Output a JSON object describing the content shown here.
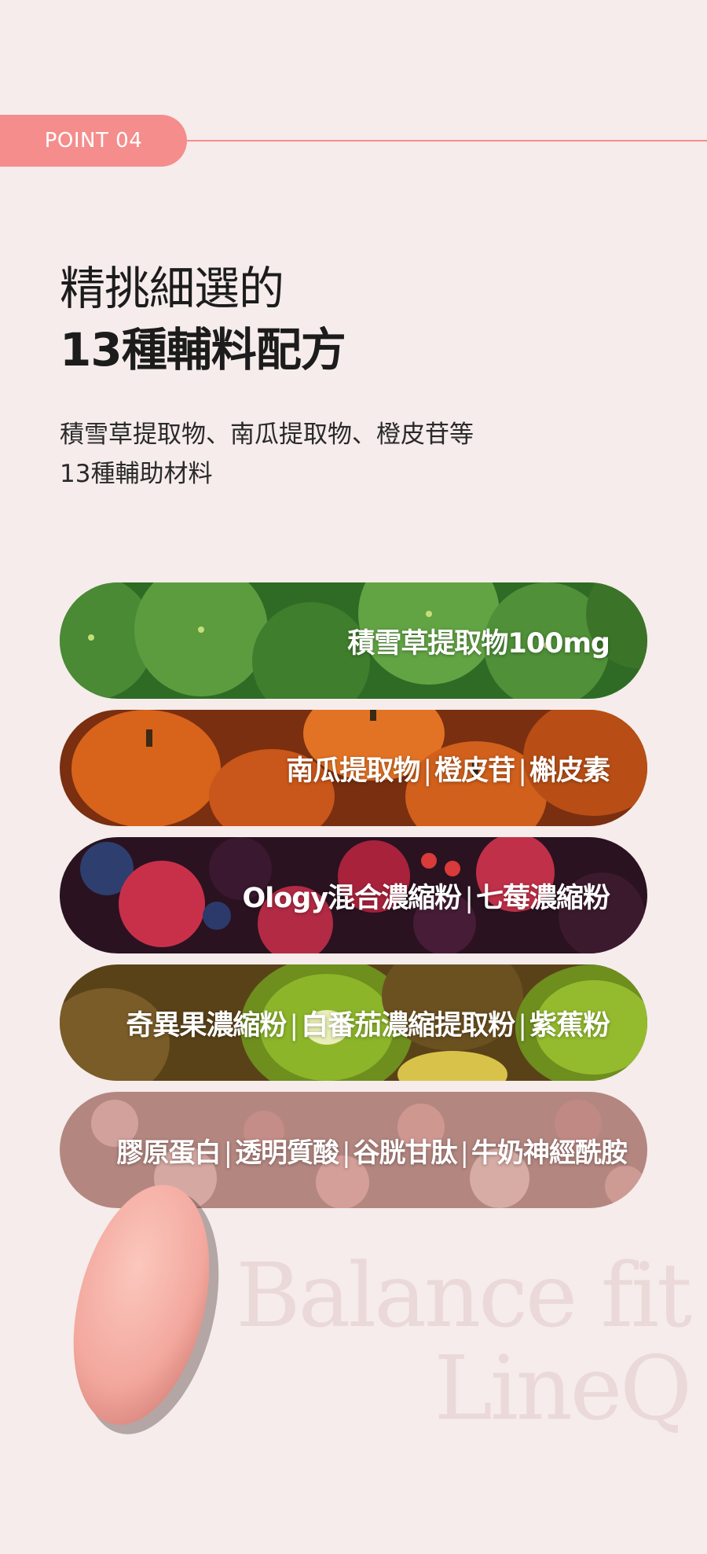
{
  "point": {
    "label": "POINT 04"
  },
  "headline": {
    "line1": "精挑細選的",
    "line2": "13種輔料配方"
  },
  "description": {
    "line1": "積雪草提取物、南瓜提取物、橙皮苷等",
    "line2": "13種輔助材料"
  },
  "ingredients": [
    {
      "items": [
        "積雪草提取物100mg"
      ],
      "theme": "centella-leaves"
    },
    {
      "items": [
        "南瓜提取物",
        "橙皮苷",
        "槲皮素"
      ],
      "theme": "pumpkins"
    },
    {
      "items": [
        "Ology混合濃縮粉",
        "七莓濃縮粉"
      ],
      "theme": "berries"
    },
    {
      "items": [
        "奇異果濃縮粉",
        "白番茄濃縮提取粉",
        "紫蕉粉"
      ],
      "theme": "kiwi"
    },
    {
      "items": [
        "膠原蛋白",
        "透明質酸",
        "谷胱甘肽",
        "牛奶神經酰胺"
      ],
      "theme": "collagen-bubbles"
    }
  ],
  "watermark": {
    "line1": "Balance fit",
    "line2": "LineQ"
  },
  "colors": {
    "accent": "#f58d8d",
    "background": "#f5eceb",
    "tablet": "#f3a89e"
  }
}
